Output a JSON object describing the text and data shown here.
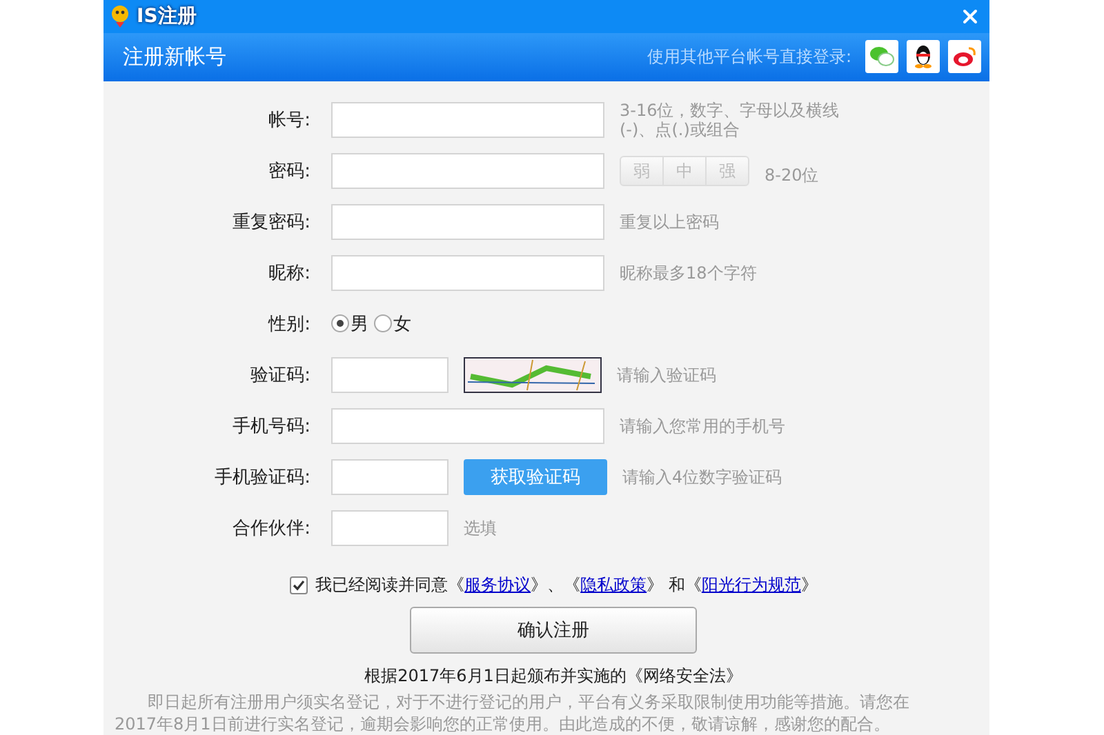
{
  "window": {
    "title": "IS注册"
  },
  "header": {
    "title": "注册新帐号",
    "social_login_label": "使用其他平台帐号直接登录:"
  },
  "form": {
    "rows": [
      {
        "kind": "text",
        "label": "帐号:",
        "hint": "3-16位，数字、字母以及横线(-)、点(.)或组合"
      },
      {
        "kind": "password",
        "label": "密码:",
        "strength": [
          "弱",
          "中",
          "强"
        ],
        "hint": "8-20位"
      },
      {
        "kind": "text",
        "label": "重复密码:",
        "hint": "重复以上密码"
      },
      {
        "kind": "text",
        "label": "昵称:",
        "hint": "昵称最多18个字符"
      },
      {
        "kind": "radio",
        "label": "性别:",
        "options": [
          {
            "label": "男",
            "selected": true
          },
          {
            "label": "女",
            "selected": false
          }
        ]
      },
      {
        "kind": "captcha",
        "label": "验证码:",
        "hint": "请输入验证码"
      },
      {
        "kind": "text",
        "label": "手机号码:",
        "hint": "请输入您常用的手机号"
      },
      {
        "kind": "sms",
        "label": "手机验证码:",
        "button": "获取验证码",
        "hint": "请输入4位数字验证码"
      },
      {
        "kind": "short",
        "label": "合作伙伴:",
        "hint": "选填"
      }
    ]
  },
  "agreement": {
    "checked": true,
    "parts": [
      {
        "kind": "text",
        "text": "我已经阅读并同意《"
      },
      {
        "kind": "link",
        "text": "服务协议"
      },
      {
        "kind": "text",
        "text": "》、《"
      },
      {
        "kind": "link",
        "text": "隐私政策"
      },
      {
        "kind": "text",
        "text": "》 和《"
      },
      {
        "kind": "link",
        "text": "阳光行为规范"
      },
      {
        "kind": "text",
        "text": "》"
      }
    ]
  },
  "submit": "确认注册",
  "notice": {
    "title": "根据2017年6月1日起颁布并实施的《网络安全法》",
    "body": "即日起所有注册用户须实名登记，对于不进行登记的用户，平台有义务采取限制使用功能等措施。请您在2017年8月1日前进行实名登记，逾期会影响您的正常使用。由此造成的不便，敬请谅解，感谢您的配合。"
  }
}
